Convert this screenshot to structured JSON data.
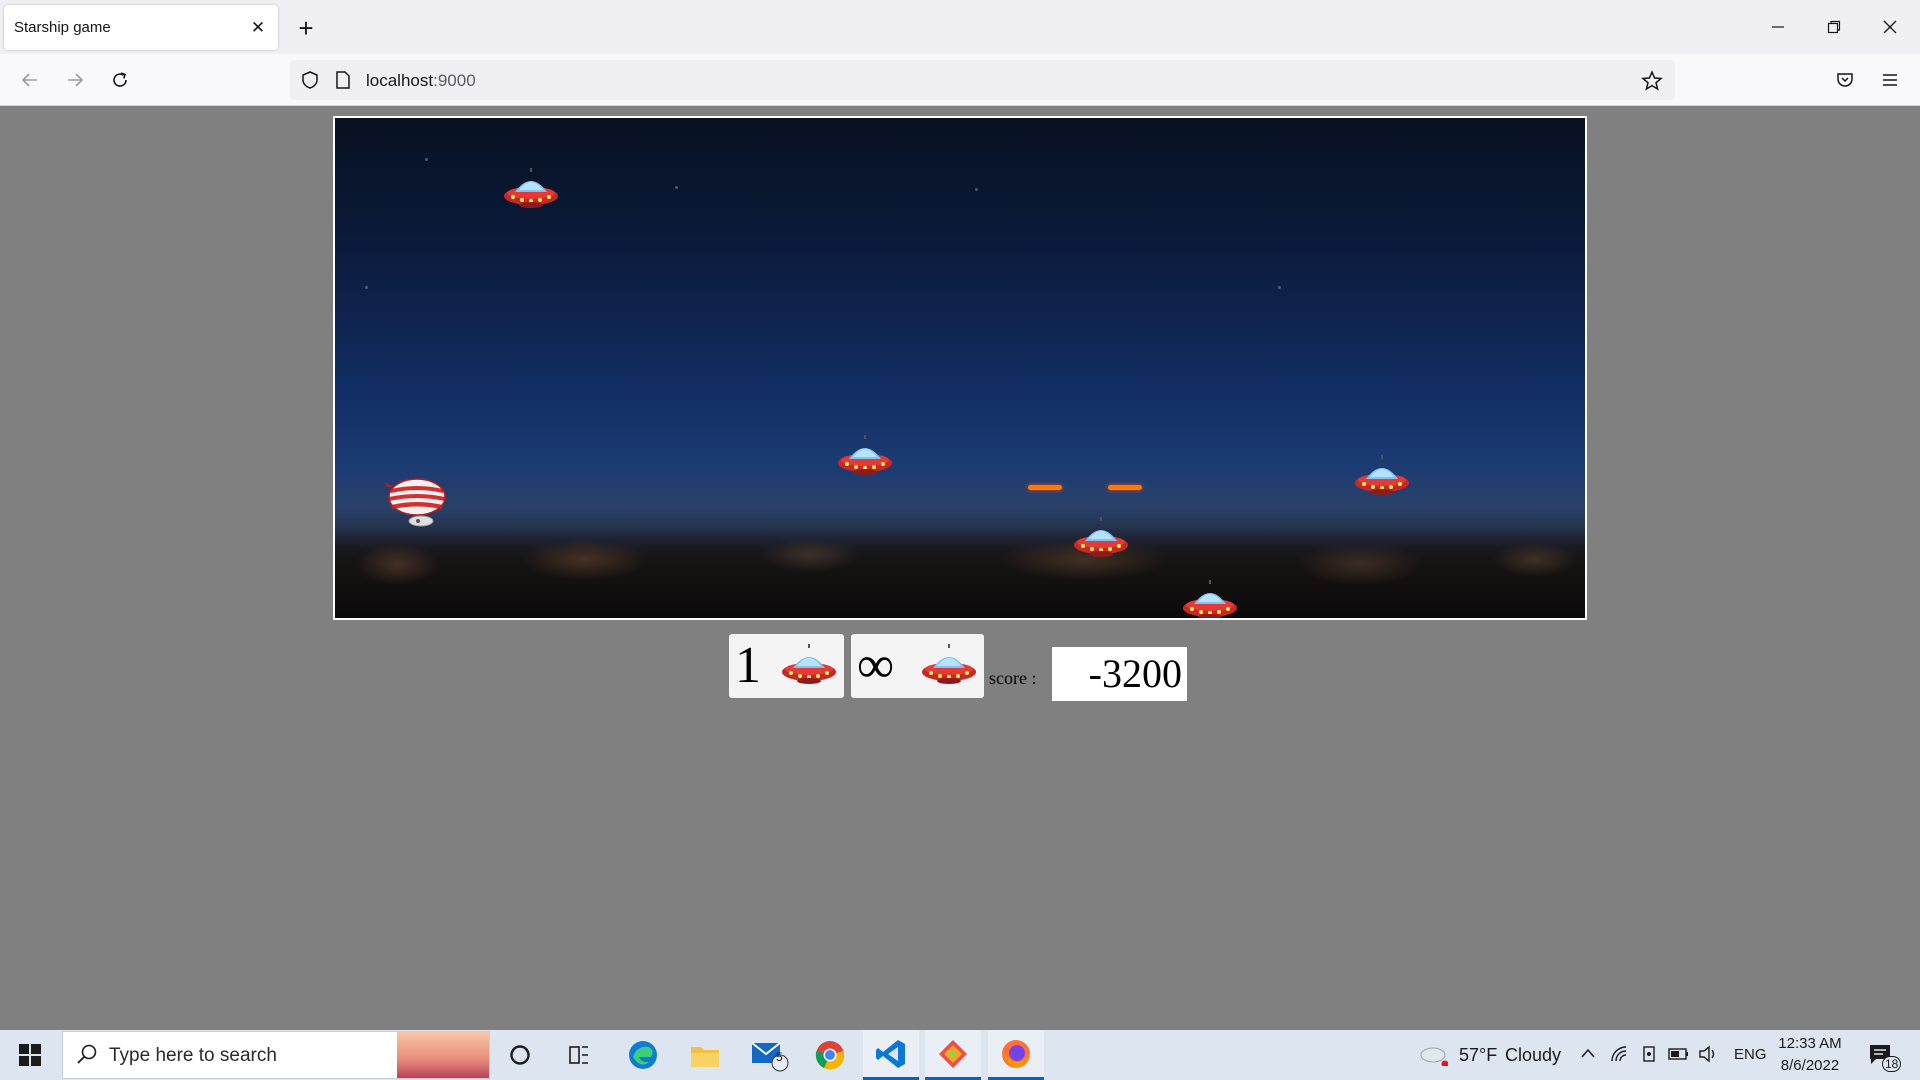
{
  "browser": {
    "tab_title": "Starship game",
    "url_host": "localhost",
    "url_port": ":9000"
  },
  "game": {
    "lives_count": "1",
    "bombs_count": "∞",
    "score_label": "score :",
    "score_value": "-3200"
  },
  "taskbar": {
    "search_placeholder": "Type here to search",
    "weather_temp": "57°F",
    "weather_text": "Cloudy",
    "language": "ENG",
    "time": "12:33 AM",
    "date": "8/6/2022",
    "mail_badge": "5",
    "notification_count": "18"
  }
}
